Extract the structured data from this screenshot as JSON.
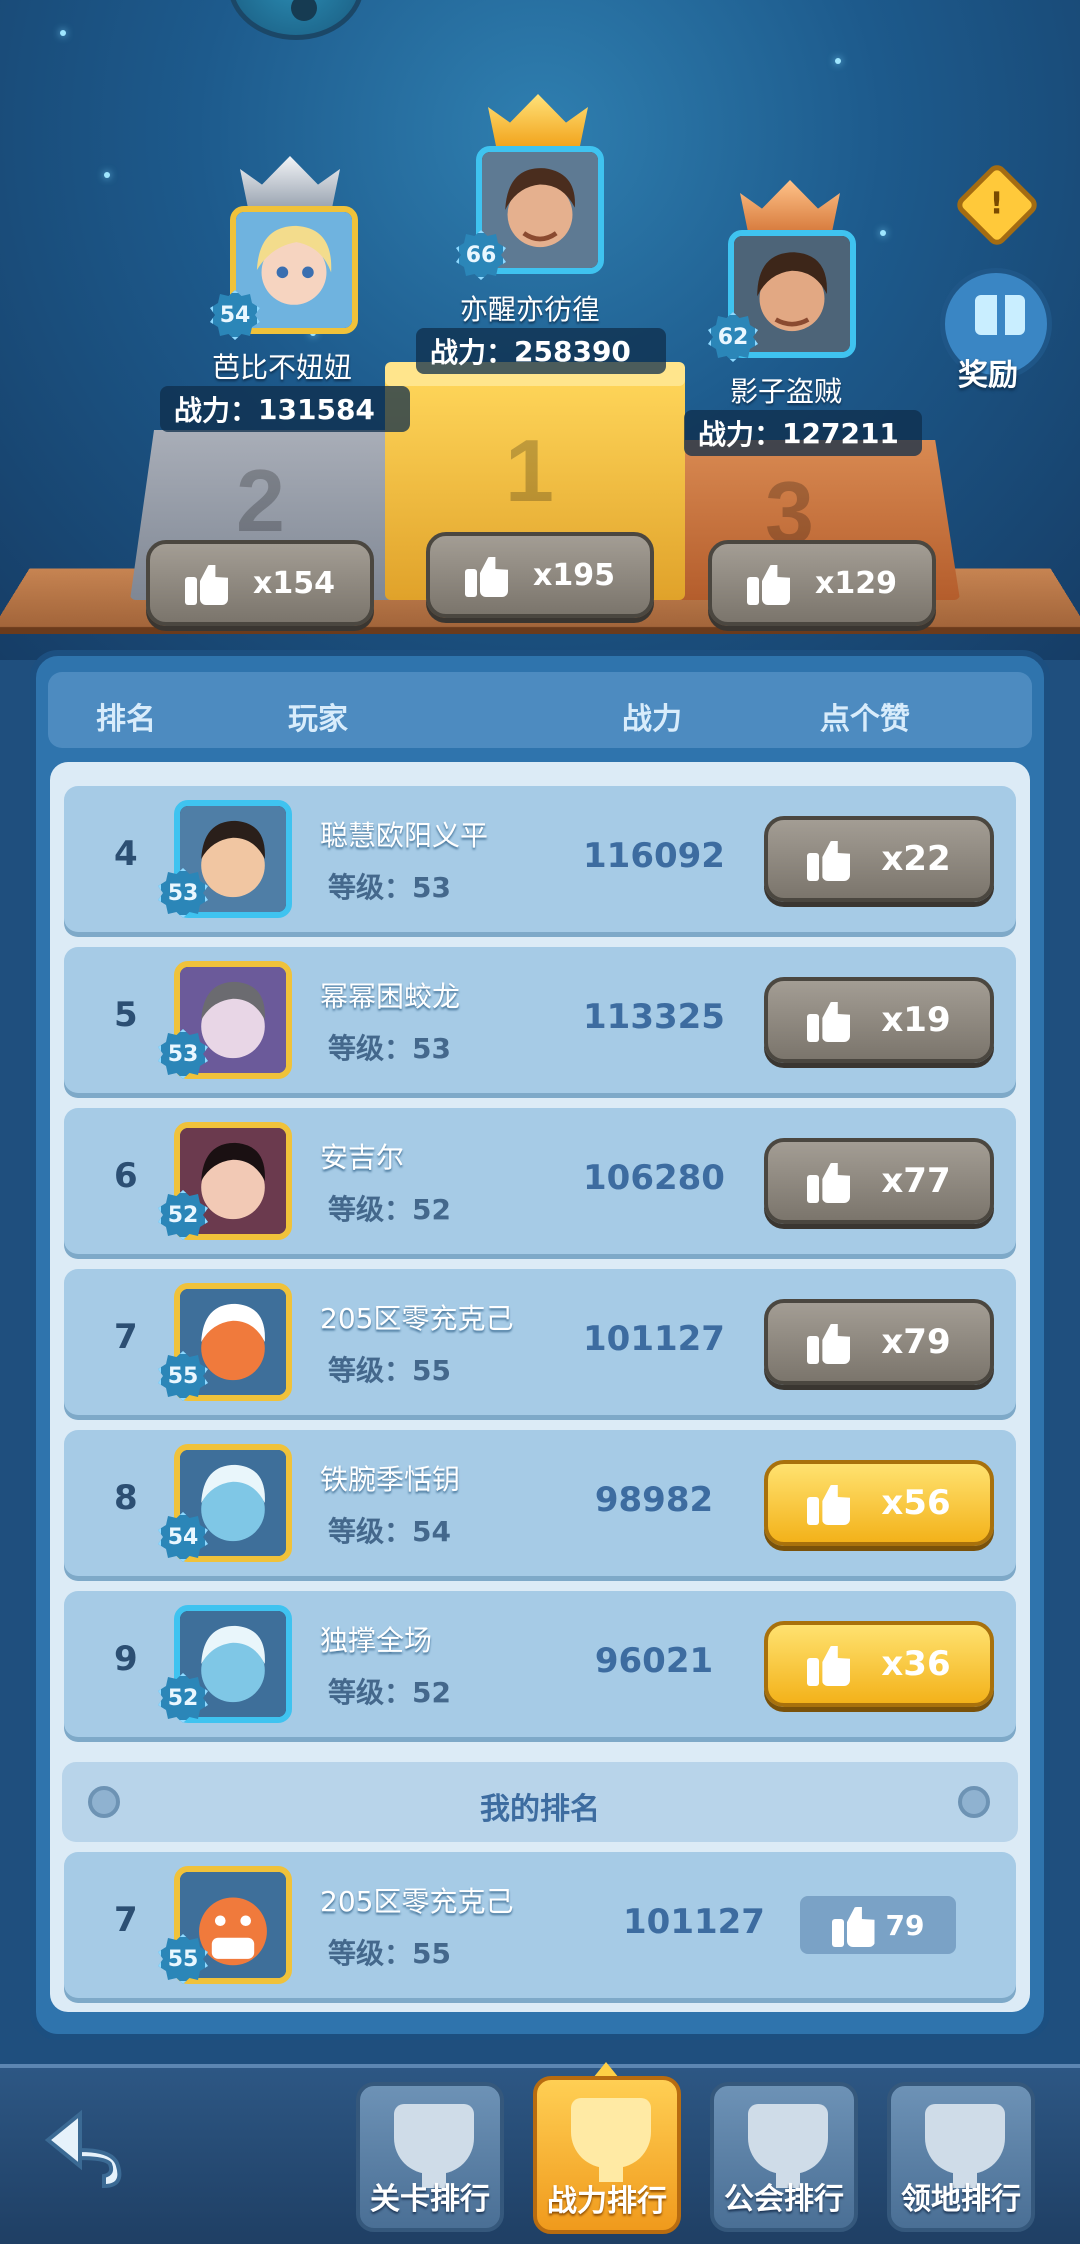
{
  "podium": {
    "first": {
      "name": "亦醒亦彷徨",
      "level": "66",
      "power_label": "战力：",
      "power": "258390",
      "likes": "x195",
      "place": "1"
    },
    "second": {
      "name": "芭比不妞妞",
      "level": "54",
      "power_label": "战力：",
      "power": "131584",
      "likes": "x154",
      "place": "2"
    },
    "third": {
      "name": "影子盗贼",
      "level": "62",
      "power_label": "战力：",
      "power": "127211",
      "likes": "x129",
      "place": "3"
    }
  },
  "side": {
    "info_icon": "!",
    "reward_label": "奖励"
  },
  "table": {
    "headers": {
      "rank": "排名",
      "player": "玩家",
      "power": "战力",
      "like": "点个赞"
    },
    "level_prefix": "等级：",
    "rows": [
      {
        "rank": "4",
        "name": "聪慧欧阳义平",
        "level": "53",
        "power": "116092",
        "likes": "x22",
        "liked": false
      },
      {
        "rank": "5",
        "name": "幂幂困蛟龙",
        "level": "53",
        "power": "113325",
        "likes": "x19",
        "liked": false
      },
      {
        "rank": "6",
        "name": "安吉尔",
        "level": "52",
        "power": "106280",
        "likes": "x77",
        "liked": false
      },
      {
        "rank": "7",
        "name": "205区零充克己",
        "level": "55",
        "power": "101127",
        "likes": "x79",
        "liked": false
      },
      {
        "rank": "8",
        "name": "铁腕季恬钥",
        "level": "54",
        "power": "98982",
        "likes": "x56",
        "liked": true
      },
      {
        "rank": "9",
        "name": "独撑全场",
        "level": "52",
        "power": "96021",
        "likes": "x36",
        "liked": true
      }
    ]
  },
  "my_rank": {
    "label": "我的排名",
    "rank": "7",
    "name": "205区零充克己",
    "level": "55",
    "power": "101127",
    "likes": "79"
  },
  "tabs": [
    {
      "label": "关卡排行",
      "active": false
    },
    {
      "label": "战力排行",
      "active": true
    },
    {
      "label": "公会排行",
      "active": false
    },
    {
      "label": "领地排行",
      "active": false
    }
  ],
  "colors": {
    "gold": "#f0c23a",
    "grey_button": "#8f8980",
    "yellow_button": "#f8c53a",
    "panel": "#2f74ad",
    "row": "#a6cbe6"
  }
}
